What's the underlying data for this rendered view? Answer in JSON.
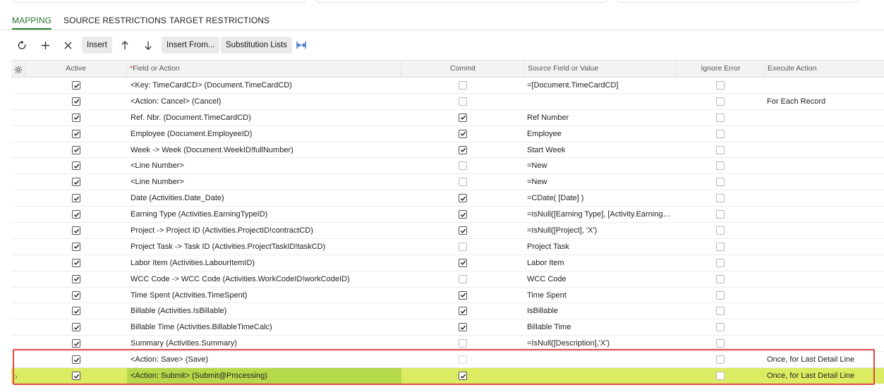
{
  "tabs": [
    {
      "label": "MAPPING",
      "active": true
    },
    {
      "label": "SOURCE RESTRICTIONS",
      "active": false
    },
    {
      "label": "TARGET RESTRICTIONS",
      "active": false
    }
  ],
  "toolbar": {
    "icons": [
      "refresh-icon",
      "add-icon",
      "delete-icon"
    ],
    "insert_label": "Insert",
    "move_icons": [
      "arrow-up-icon",
      "arrow-down-icon"
    ],
    "insert_from_label": "Insert From...",
    "substitution_lists_label": "Substitution Lists",
    "fit_icon": "fit-columns-icon"
  },
  "grid": {
    "settings_icon": "gear-icon",
    "columns": {
      "active": "Active",
      "field_required_mark": "*",
      "field": "Field or Action",
      "commit": "Commit",
      "source": "Source Field or Value",
      "ignore_error": "Ignore Error",
      "execute_action": "Execute Action"
    },
    "rows": [
      {
        "active": true,
        "field": "<Key: TimeCardCD> (Document.TimeCardCD)",
        "commit": false,
        "source": "=[Document.TimeCardCD]",
        "ignore_error": false,
        "execute_action": ""
      },
      {
        "active": true,
        "field": "<Action: Cancel> (Cancel)",
        "commit": false,
        "source": "",
        "ignore_error": false,
        "execute_action": "For Each Record"
      },
      {
        "active": true,
        "field": "Ref. Nbr. (Document.TimeCardCD)",
        "commit": true,
        "source": "Ref Number",
        "ignore_error": false,
        "execute_action": ""
      },
      {
        "active": true,
        "field": "Employee (Document.EmployeeID)",
        "commit": true,
        "source": "Employee",
        "ignore_error": false,
        "execute_action": ""
      },
      {
        "active": true,
        "field": "Week -> Week (Document.WeekID!fullNumber)",
        "commit": true,
        "source": "Start Week",
        "ignore_error": false,
        "execute_action": ""
      },
      {
        "active": true,
        "field": "<Line Number>",
        "commit": false,
        "source": "=New",
        "ignore_error": false,
        "execute_action": ""
      },
      {
        "active": true,
        "field": "<Line Number>",
        "commit": false,
        "source": "=New",
        "ignore_error": false,
        "execute_action": ""
      },
      {
        "active": true,
        "field": "Date (Activities.Date_Date)",
        "commit": true,
        "source": "=CDate( [Date] )",
        "ignore_error": false,
        "execute_action": ""
      },
      {
        "active": true,
        "field": "Earning Type (Activities.EarningTypeID)",
        "commit": true,
        "source": "=IsNull([Earning Type], [Activity.EarningTy…",
        "ignore_error": false,
        "execute_action": ""
      },
      {
        "active": true,
        "field": "Project -> Project ID (Activities.ProjectID!contractCD)",
        "commit": true,
        "source": "=IsNull([Project], 'X')",
        "ignore_error": false,
        "execute_action": ""
      },
      {
        "active": true,
        "field": "Project Task -> Task ID (Activities.ProjectTaskID!taskCD)",
        "commit": false,
        "source": "Project Task",
        "ignore_error": false,
        "execute_action": ""
      },
      {
        "active": true,
        "field": "Labor Item (Activities.LabourItemID)",
        "commit": true,
        "source": "Labor Item",
        "ignore_error": false,
        "execute_action": ""
      },
      {
        "active": true,
        "field": "WCC Code -> WCC Code (Activities.WorkCodeID!workCodeID)",
        "commit": false,
        "source": "WCC Code",
        "ignore_error": false,
        "execute_action": ""
      },
      {
        "active": true,
        "field": "Time Spent (Activities.TimeSpent)",
        "commit": true,
        "source": "Time Spent",
        "ignore_error": false,
        "execute_action": ""
      },
      {
        "active": true,
        "field": "Billable (Activities.IsBillable)",
        "commit": true,
        "source": "IsBillable",
        "ignore_error": false,
        "execute_action": ""
      },
      {
        "active": true,
        "field": "Billable Time (Activities.BillableTimeCalc)",
        "commit": true,
        "source": "Billable Time",
        "ignore_error": false,
        "execute_action": ""
      },
      {
        "active": true,
        "field": "Summary (Activities.Summary)",
        "commit": false,
        "source": "=IsNull([Description],'X')",
        "ignore_error": false,
        "execute_action": ""
      },
      {
        "active": true,
        "field": "<Action: Save> (Save)",
        "commit": false,
        "source": "",
        "ignore_error": false,
        "execute_action": "Once, for Last Detail Line"
      },
      {
        "active": true,
        "field": "<Action: Submit> (Submit@Processing)",
        "commit": true,
        "source": "",
        "ignore_error": false,
        "execute_action": "Once, for Last Detail Line",
        "selected": true
      }
    ]
  },
  "colors": {
    "active_tab": "#2a7d31",
    "selected_row": "#dcec62",
    "selected_field_cell": "#b5d94a",
    "highlight_border": "#e04848"
  }
}
